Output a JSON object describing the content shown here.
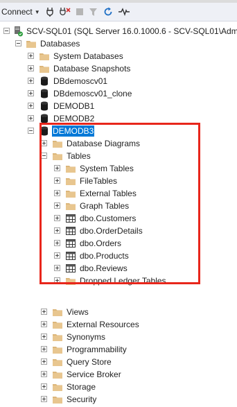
{
  "toolbar": {
    "connect_label": "Connect",
    "icons": [
      "connect-icon",
      "disconnect-icon",
      "stop-icon",
      "filter-icon",
      "refresh-icon",
      "activity-monitor-icon"
    ]
  },
  "tree": {
    "server": "SCV-SQL01 (SQL Server 16.0.1000.6 - SCV-SQL01\\Admini",
    "databases": "Databases",
    "system_databases": "System Databases",
    "database_snapshots": "Database Snapshots",
    "db1": "DBdemoscv01",
    "db2": "DBdemoscv01_clone",
    "db3": "DEMODB1",
    "db4": "DEMODB2",
    "db5": "DEMODB3",
    "database_diagrams": "Database Diagrams",
    "tables": "Tables",
    "system_tables": "System Tables",
    "file_tables": "FileTables",
    "external_tables": "External Tables",
    "graph_tables": "Graph Tables",
    "t_customers": "dbo.Customers",
    "t_orderdetails": "dbo.OrderDetails",
    "t_orders": "dbo.Orders",
    "t_products": "dbo.Products",
    "t_reviews": "dbo.Reviews",
    "dropped_ledger": "Dropped Ledger Tables",
    "views": "Views",
    "external_resources": "External Resources",
    "synonyms": "Synonyms",
    "programmability": "Programmability",
    "query_store": "Query Store",
    "service_broker": "Service Broker",
    "storage": "Storage",
    "security": "Security"
  },
  "colors": {
    "selection": "#0078d7",
    "highlight_box": "#e8261b",
    "folder": "#dcb67a"
  }
}
